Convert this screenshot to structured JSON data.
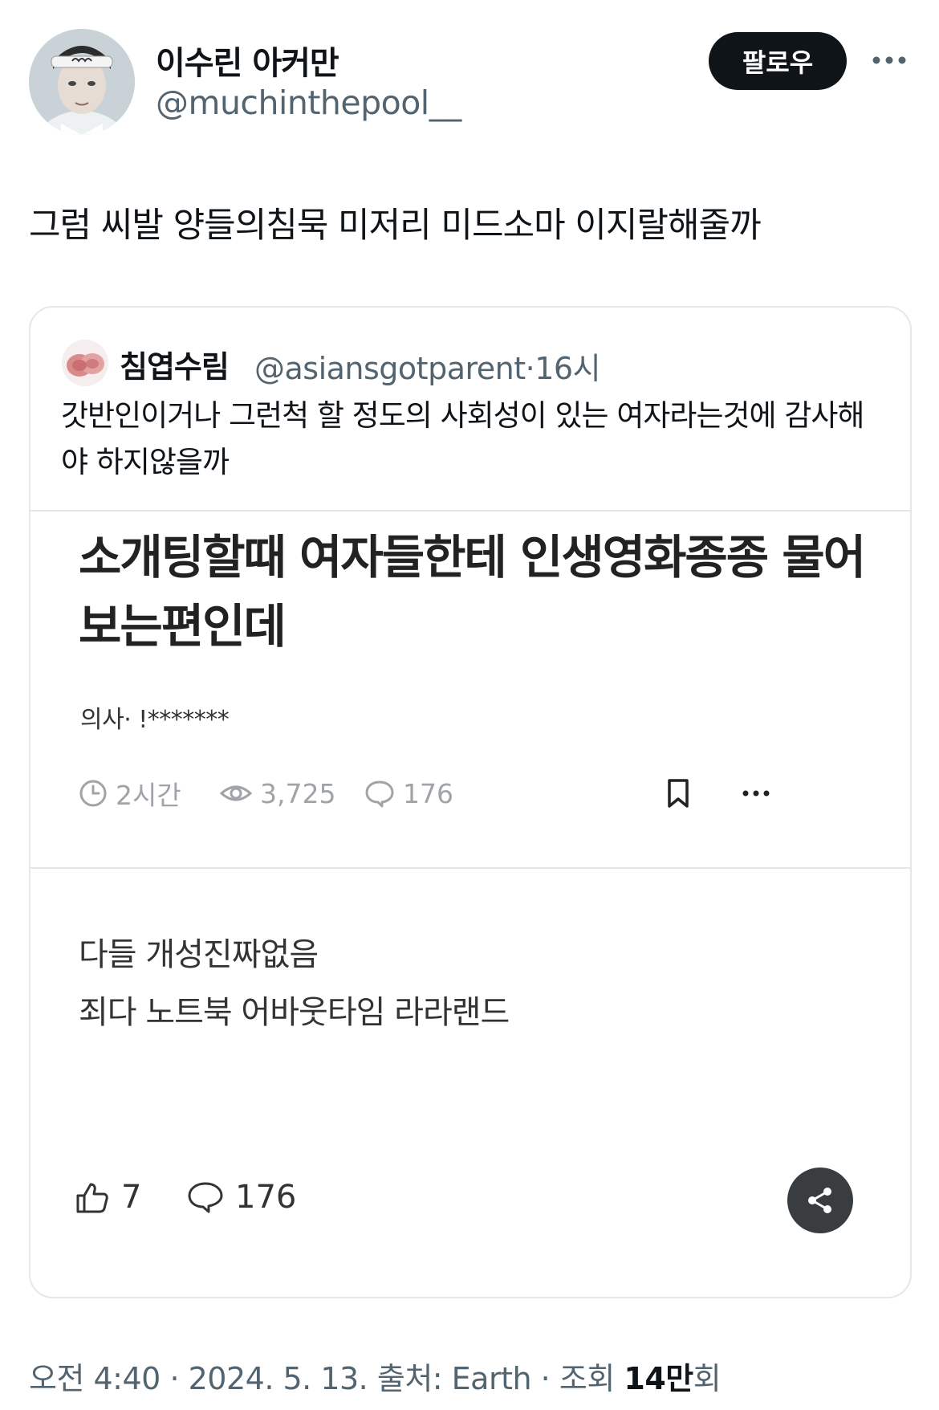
{
  "author": {
    "display_name": "이수린 아커만",
    "handle": "@muchinthepool__"
  },
  "follow_label": "팔로우",
  "tweet_text": "그럼 씨발 양들의침묵 미저리 미드소마 이지랄해줄까",
  "quote": {
    "display_name": "침엽수림",
    "handle": "@asiansgotparent",
    "separator": "·",
    "time": "16시",
    "text": "갓반인이거나 그런척 할 정도의 사회성이 있는 여자라는것에 감사해야 하지않을까",
    "embedded_post": {
      "title": "소개팅할때 여자들한테 인생영화종종 물어보는편인데",
      "author": "의사· !*******",
      "time": "2시간",
      "views": "3,725",
      "comments": "176",
      "comment_lines": [
        "다들 개성진짜없음",
        "죄다 노트북 어바웃타임 라라랜드"
      ],
      "likes": "7",
      "comment_count": "176"
    }
  },
  "meta": {
    "time": "오전 4:40",
    "date": "2024. 5. 13.",
    "source": "출처: Earth",
    "views_prefix": "조회",
    "views_value": "14만",
    "views_suffix": "회",
    "dot": "·"
  },
  "icons": {
    "more": "more-horizontal-icon",
    "clock": "clock-icon",
    "eye": "eye-icon",
    "speech": "speech-bubble-icon",
    "bookmark": "bookmark-icon",
    "thumbs_up": "thumbs-up-icon",
    "share": "share-icon"
  },
  "colors": {
    "follow_button_bg": "#0f1419",
    "secondary_text": "#536471",
    "share_button_bg": "#3a3d40"
  }
}
